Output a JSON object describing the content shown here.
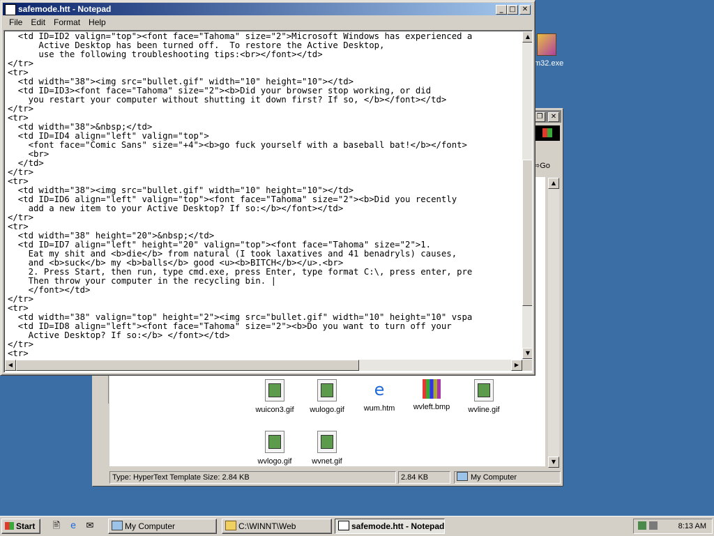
{
  "desktop": {
    "icon_label": "m32.exe"
  },
  "notepad": {
    "title": "safemode.htt - Notepad",
    "menu": [
      "File",
      "Edit",
      "Format",
      "Help"
    ],
    "lines": [
      "  <td ID=ID2 valign=\"top\"><font face=\"Tahoma\" size=\"2\">Microsoft Windows has experienced a",
      "      Active Desktop has been turned off.  To restore the Active Desktop,",
      "      use the following troubleshooting tips:<br></font></td>",
      "</tr>",
      "<tr>",
      "  <td width=\"38\"><img src=\"bullet.gif\" width=\"10\" height=\"10\"></td>",
      "  <td ID=ID3><font face=\"Tahoma\" size=\"2\"><b>Did your browser stop working, or did",
      "    you restart your computer without shutting it down first? If so, </b></font></td>",
      "</tr>",
      "<tr>",
      "  <td width=\"38\">&nbsp;</td>",
      "  <td ID=ID4 align=\"left\" valign=\"top\">",
      "    <font face=\"Comic Sans\" size=\"+4\"><b>go fuck yourself with a baseball bat!</b></font>",
      "    <br>",
      "  </td>",
      "</tr>",
      "<tr>",
      "  <td width=\"38\"><img src=\"bullet.gif\" width=\"10\" height=\"10\"></td>",
      "  <td ID=ID6 align=\"left\" valign=\"top\"><font face=\"Tahoma\" size=\"2\"><b>Did you recently",
      "    add a new item to your Active Desktop? If so:</b></font></td>",
      "</tr>",
      "<tr>",
      "  <td width=\"38\" height=\"20\">&nbsp;</td>",
      "  <td ID=ID7 align=\"left\" height=\"20\" valign=\"top\"><font face=\"Tahoma\" size=\"2\">1.",
      "    Eat my shit and <b>die</b> from natural (I took laxatives and 41 benadryls) causes,",
      "    and <b>suck</b> my <b>balls</b> good <u><b>BITCH</b></u>.<br>",
      "    2. Press Start, then run, type cmd.exe, press Enter, type format C:\\, press enter, pre",
      "    Then throw your computer in the recycling bin. |",
      "    </font></td>",
      "</tr>",
      "<tr>",
      "  <td width=\"38\" valign=\"top\" height=\"2\"><img src=\"bullet.gif\" width=\"10\" height=\"10\" vspa",
      "  <td ID=ID8 align=\"left\"><font face=\"Tahoma\" size=\"2\"><b>Do you want to turn off your",
      "    Active Desktop? If so:</b> </font></td>",
      "</tr>",
      "<tr>"
    ]
  },
  "explorer": {
    "go_label": "Go",
    "files": [
      {
        "name": "wuicon3.gif",
        "icon": "gif-image-icon"
      },
      {
        "name": "wulogo.gif",
        "icon": "gif-image-icon"
      },
      {
        "name": "wum.htm",
        "icon": "internet-explorer-icon"
      },
      {
        "name": "wvleft.bmp",
        "icon": "bitmap-image-icon"
      },
      {
        "name": "wvline.gif",
        "icon": "gif-image-icon"
      },
      {
        "name": "wvlogo.gif",
        "icon": "gif-image-icon"
      },
      {
        "name": "wvnet.gif",
        "icon": "gif-image-icon"
      }
    ],
    "status": {
      "info": "Type: HyperText Template Size: 2.84 KB",
      "size": "2.84 KB",
      "zone": "My Computer"
    }
  },
  "taskbar": {
    "start_label": "Start",
    "tasks": [
      {
        "label": "My Computer",
        "active": false
      },
      {
        "label": "C:\\WINNT\\Web",
        "active": false
      },
      {
        "label": "safemode.htt - Notepad",
        "active": true
      }
    ],
    "clock": "8:13 AM"
  },
  "colors": {
    "desktop": "#3a6ea5",
    "active_title_start": "#0a246a",
    "active_title_end": "#a6caf0",
    "chrome": "#d4d0c8"
  }
}
